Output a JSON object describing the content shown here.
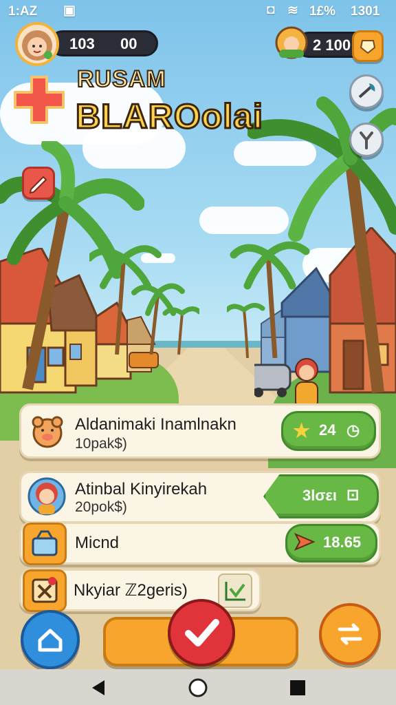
{
  "status_bar": {
    "time_left": "1:AZ",
    "battery": "1£%",
    "time_right": "1301"
  },
  "hud": {
    "left_stat_a": "103",
    "left_stat_b": "00",
    "coins": "2 100"
  },
  "title": {
    "line1": "RUSAM",
    "line2": "BLAROolai"
  },
  "cards": [
    {
      "title": "Aldanimaki Inamlnakn",
      "subtitle": "10pak$)",
      "action": "24"
    },
    {
      "title": "Atinbal Kinyirekah",
      "subtitle": "20pok$)",
      "action": "3lσει"
    },
    {
      "title": "Micnd",
      "subtitle": "",
      "action": "18.65"
    },
    {
      "title": "Nkyiar ℤ2geris)",
      "subtitle": "",
      "action": ""
    }
  ],
  "colors": {
    "accent_green": "#68b845",
    "accent_orange": "#f7a52c",
    "accent_red": "#e0343a",
    "accent_blue": "#2f8fdc"
  },
  "icons": [
    "avatar-icon",
    "wallet-icon",
    "medkit-icon",
    "pencil-icon",
    "axe-icon",
    "slingshot-icon",
    "star-icon",
    "clock-icon",
    "shop-basket-icon",
    "arrow-icon",
    "map-pin-icon",
    "check-icon",
    "home-icon",
    "swap-icon"
  ]
}
